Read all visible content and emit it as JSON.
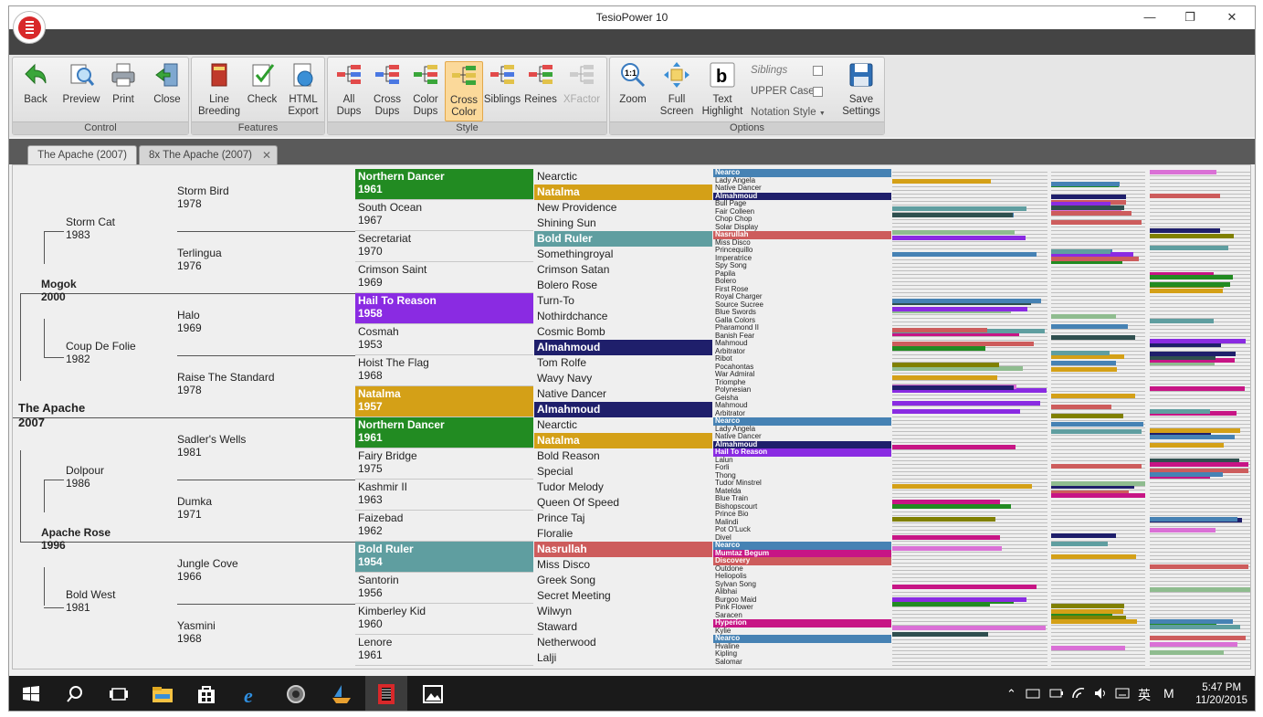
{
  "window": {
    "title": "TesioPower 10"
  },
  "ribbon": {
    "groups": [
      {
        "label": "Control",
        "buttons": [
          "Back",
          "Preview",
          "Print",
          "Close"
        ]
      },
      {
        "label": "Features",
        "buttons": [
          "Line Breeding",
          "Check",
          "HTML Export"
        ]
      },
      {
        "label": "Style",
        "buttons": [
          "All Dups",
          "Cross Dups",
          "Color Dups",
          "Cross Color",
          "Siblings",
          "Reines",
          "XFactor"
        ]
      },
      {
        "label": "Options",
        "buttons": [
          "Zoom",
          "Full Screen",
          "Text Highlight",
          "Save Settings"
        ]
      }
    ],
    "options": {
      "siblings": "Siblings",
      "upper_case": "UPPER Case",
      "notation_style": "Notation Style"
    }
  },
  "tabs": [
    "The Apache (2007)",
    "8x The Apache (2007)"
  ],
  "colors": {
    "green": "#228b22",
    "gold": "#d4a017",
    "teal": "#5f9ea0",
    "purple": "#8a2be2",
    "navy": "#1f1f6b",
    "salmon": "#cd5c5c",
    "blue": "#4682b4",
    "magenta": "#c71585"
  },
  "pedigree": {
    "gen1": {
      "name": "The Apache",
      "year": "2007"
    },
    "gen2": [
      {
        "name": "Mogok",
        "year": "2000"
      },
      {
        "name": "Apache Rose",
        "year": "1996"
      }
    ],
    "gen3": [
      {
        "name": "Storm Cat",
        "year": "1983"
      },
      {
        "name": "Coup De Folie",
        "year": "1982"
      },
      {
        "name": "Dolpour",
        "year": "1986"
      },
      {
        "name": "Bold West",
        "year": "1981"
      }
    ],
    "gen4": [
      {
        "name": "Storm Bird",
        "year": "1978"
      },
      {
        "name": "Terlingua",
        "year": "1976"
      },
      {
        "name": "Halo",
        "year": "1969"
      },
      {
        "name": "Raise The Standard",
        "year": "1978"
      },
      {
        "name": "Sadler's Wells",
        "year": "1981"
      },
      {
        "name": "Dumka",
        "year": "1971"
      },
      {
        "name": "Jungle Cove",
        "year": "1966"
      },
      {
        "name": "Yasmini",
        "year": "1968"
      }
    ],
    "gen5": [
      {
        "name": "Northern Dancer",
        "year": "1961",
        "color": "green"
      },
      {
        "name": "South Ocean",
        "year": "1967"
      },
      {
        "name": "Secretariat",
        "year": "1970"
      },
      {
        "name": "Crimson Saint",
        "year": "1969"
      },
      {
        "name": "Hail To Reason",
        "year": "1958",
        "color": "purple"
      },
      {
        "name": "Cosmah",
        "year": "1953"
      },
      {
        "name": "Hoist The Flag",
        "year": "1968"
      },
      {
        "name": "Natalma",
        "year": "1957",
        "color": "gold"
      },
      {
        "name": "Northern Dancer",
        "year": "1961",
        "color": "green"
      },
      {
        "name": "Fairy Bridge",
        "year": "1975"
      },
      {
        "name": "Kashmir II",
        "year": "1963"
      },
      {
        "name": "Faizebad",
        "year": "1962"
      },
      {
        "name": "Bold Ruler",
        "year": "1954",
        "color": "teal"
      },
      {
        "name": "Santorin",
        "year": "1956"
      },
      {
        "name": "Kimberley Kid",
        "year": "1960"
      },
      {
        "name": "Lenore",
        "year": "1961"
      }
    ],
    "gen6": [
      {
        "name": "Nearctic"
      },
      {
        "name": "Natalma",
        "color": "gold"
      },
      {
        "name": "New Providence"
      },
      {
        "name": "Shining Sun"
      },
      {
        "name": "Bold Ruler",
        "color": "teal"
      },
      {
        "name": "Somethingroyal"
      },
      {
        "name": "Crimson Satan"
      },
      {
        "name": "Bolero Rose"
      },
      {
        "name": "Turn-To"
      },
      {
        "name": "Nothirdchance"
      },
      {
        "name": "Cosmic Bomb"
      },
      {
        "name": "Almahmoud",
        "color": "navy"
      },
      {
        "name": "Tom Rolfe"
      },
      {
        "name": "Wavy Navy"
      },
      {
        "name": "Native Dancer"
      },
      {
        "name": "Almahmoud",
        "color": "navy"
      },
      {
        "name": "Nearctic"
      },
      {
        "name": "Natalma",
        "color": "gold"
      },
      {
        "name": "Bold Reason"
      },
      {
        "name": "Special"
      },
      {
        "name": "Tudor Melody"
      },
      {
        "name": "Queen Of Speed"
      },
      {
        "name": "Prince Taj"
      },
      {
        "name": "Floralie"
      },
      {
        "name": "Nasrullah",
        "color": "salmon"
      },
      {
        "name": "Miss Disco"
      },
      {
        "name": "Greek Song"
      },
      {
        "name": "Secret Meeting"
      },
      {
        "name": "Wilwyn"
      },
      {
        "name": "Staward"
      },
      {
        "name": "Netherwood"
      },
      {
        "name": "Lalji"
      }
    ],
    "gen7": [
      {
        "name": "Nearco",
        "color": "blue"
      },
      {
        "name": "Lady Angela"
      },
      {
        "name": "Native Dancer"
      },
      {
        "name": "Almahmoud",
        "color": "navy"
      },
      {
        "name": "Bull Page"
      },
      {
        "name": "Fair Colleen"
      },
      {
        "name": "Chop Chop"
      },
      {
        "name": "Solar Display"
      },
      {
        "name": "Nasrullah",
        "color": "salmon"
      },
      {
        "name": "Miss Disco"
      },
      {
        "name": "Princequillo"
      },
      {
        "name": "Imperatrice"
      },
      {
        "name": "Spy Song"
      },
      {
        "name": "Papila"
      },
      {
        "name": "Bolero"
      },
      {
        "name": "First Rose"
      },
      {
        "name": "Royal Charger"
      },
      {
        "name": "Source Sucree"
      },
      {
        "name": "Blue Swords"
      },
      {
        "name": "Galla Colors"
      },
      {
        "name": "Pharamond II"
      },
      {
        "name": "Banish Fear"
      },
      {
        "name": "Mahmoud"
      },
      {
        "name": "Arbitrator"
      },
      {
        "name": "Ribot"
      },
      {
        "name": "Pocahontas"
      },
      {
        "name": "War Admiral"
      },
      {
        "name": "Triomphe"
      },
      {
        "name": "Polynesian"
      },
      {
        "name": "Geisha"
      },
      {
        "name": "Mahmoud"
      },
      {
        "name": "Arbitrator"
      },
      {
        "name": "Nearco",
        "color": "blue"
      },
      {
        "name": "Lady Angela"
      },
      {
        "name": "Native Dancer"
      },
      {
        "name": "Almahmoud",
        "color": "navy"
      },
      {
        "name": "Hail To Reason",
        "color": "purple"
      },
      {
        "name": "Lalun"
      },
      {
        "name": "Forli"
      },
      {
        "name": "Thong"
      },
      {
        "name": "Tudor Minstrel"
      },
      {
        "name": "Matelda"
      },
      {
        "name": "Blue Train"
      },
      {
        "name": "Bishopscourt"
      },
      {
        "name": "Prince Bio"
      },
      {
        "name": "Malindi"
      },
      {
        "name": "Pot O'Luck"
      },
      {
        "name": "Divel"
      },
      {
        "name": "Nearco",
        "color": "blue"
      },
      {
        "name": "Mumtaz Begum",
        "color": "magenta"
      },
      {
        "name": "Discovery",
        "color": "salmon"
      },
      {
        "name": "Outdone"
      },
      {
        "name": "Heliopolis"
      },
      {
        "name": "Sylvan Song"
      },
      {
        "name": "Alibhai"
      },
      {
        "name": "Burgoo Maid"
      },
      {
        "name": "Pink Flower"
      },
      {
        "name": "Saracen"
      },
      {
        "name": "Hyperion",
        "color": "magenta"
      },
      {
        "name": "Kylie"
      },
      {
        "name": "Nearco",
        "color": "blue"
      },
      {
        "name": "Hvaline"
      },
      {
        "name": "Kipling"
      },
      {
        "name": "Salomar"
      }
    ]
  },
  "taskbar": {
    "clock_time": "5:47 PM",
    "clock_date": "11/20/2015",
    "ime": "英",
    "ime2": "M"
  }
}
